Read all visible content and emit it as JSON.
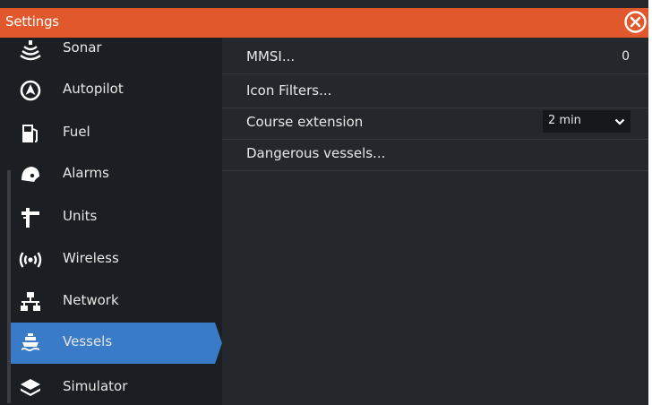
{
  "window": {
    "title": "Settings"
  },
  "sidebar": {
    "items": [
      {
        "label": "Sonar",
        "icon": "sonar-icon"
      },
      {
        "label": "Autopilot",
        "icon": "autopilot-icon"
      },
      {
        "label": "Fuel",
        "icon": "fuel-icon"
      },
      {
        "label": "Alarms",
        "icon": "alarm-bell-icon"
      },
      {
        "label": "Units",
        "icon": "units-icon"
      },
      {
        "label": "Wireless",
        "icon": "wireless-icon"
      },
      {
        "label": "Network",
        "icon": "network-icon"
      },
      {
        "label": "Vessels",
        "icon": "vessel-icon",
        "selected": true
      },
      {
        "label": "Simulator",
        "icon": "simulator-layers-icon"
      }
    ]
  },
  "main": {
    "rows": [
      {
        "label": "MMSI...",
        "value": "0"
      },
      {
        "label": "Icon Filters..."
      },
      {
        "label": "Course extension",
        "value": "2 min"
      },
      {
        "label": "Dangerous vessels..."
      }
    ]
  },
  "colors": {
    "titlebar": "#e0582b",
    "sidebar_bg": "#1b1e22",
    "content_bg": "#24272b",
    "selected": "#3a7bc8",
    "text": "#e8e8e8"
  }
}
